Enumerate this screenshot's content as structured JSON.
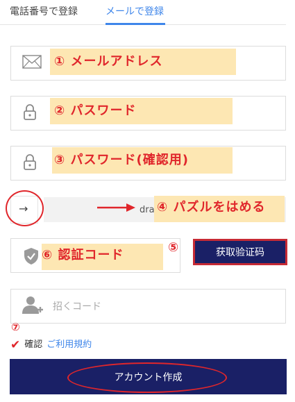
{
  "tabs": {
    "phone": "電話番号で登録",
    "email": "メールで登録"
  },
  "annotations": {
    "email": "① メールアドレス",
    "password": "② パスワード",
    "password_confirm": "③ パスワード(確認用)",
    "puzzle": "④ パズルをはめる",
    "code_button": "⑤",
    "code": "⑥ 認証コード",
    "agree": "⑦"
  },
  "slider": {
    "text": "drag to complete",
    "handle_glyph": "→"
  },
  "code_button": {
    "label": "获取验证码"
  },
  "invite": {
    "placeholder": "招くコード"
  },
  "agree": {
    "check_glyph": "✔",
    "label": "確認",
    "terms_link": "ご利用規約"
  },
  "submit": {
    "label": "アカウント作成"
  },
  "colors": {
    "accent_blue": "#3f86ea",
    "navy": "#1a2066",
    "annotation_red": "#e0262b",
    "highlight": "#fde7b3"
  }
}
